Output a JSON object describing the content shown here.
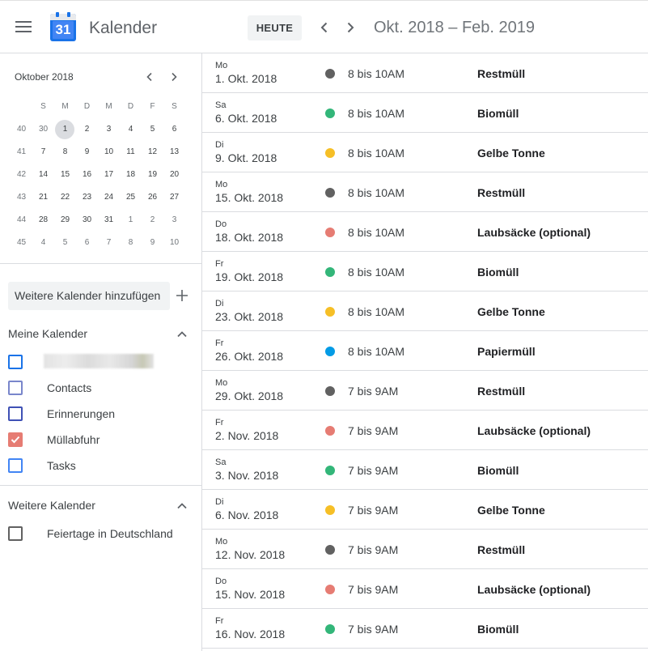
{
  "header": {
    "app_title": "Kalender",
    "logo_day": "31",
    "today_label": "HEUTE",
    "date_range": "Okt. 2018 – Feb. 2019"
  },
  "mini_calendar": {
    "title": "Oktober 2018",
    "weekdays": [
      "S",
      "M",
      "D",
      "M",
      "D",
      "F",
      "S"
    ],
    "weeks": [
      {
        "wk": "40",
        "days": [
          "30",
          "1",
          "2",
          "3",
          "4",
          "5",
          "6"
        ]
      },
      {
        "wk": "41",
        "days": [
          "7",
          "8",
          "9",
          "10",
          "11",
          "12",
          "13"
        ]
      },
      {
        "wk": "42",
        "days": [
          "14",
          "15",
          "16",
          "17",
          "18",
          "19",
          "20"
        ]
      },
      {
        "wk": "43",
        "days": [
          "21",
          "22",
          "23",
          "24",
          "25",
          "26",
          "27"
        ]
      },
      {
        "wk": "44",
        "days": [
          "28",
          "29",
          "30",
          "31",
          "1",
          "2",
          "3"
        ]
      },
      {
        "wk": "45",
        "days": [
          "4",
          "5",
          "6",
          "7",
          "8",
          "9",
          "10"
        ]
      }
    ],
    "selected_day": "1"
  },
  "sidebar": {
    "add_calendar_label": "Weitere Kalender hinzufügen",
    "my_calendars_label": "Meine Kalender",
    "my_calendars": [
      {
        "label": "",
        "color": "#1a73e8",
        "checked": false,
        "blurred": true
      },
      {
        "label": "Contacts",
        "color": "#7986cb",
        "checked": false
      },
      {
        "label": "Erinnerungen",
        "color": "#3f51b5",
        "checked": false
      },
      {
        "label": "Müllabfuhr",
        "color": "#e67c73",
        "checked": true
      },
      {
        "label": "Tasks",
        "color": "#4285f4",
        "checked": false
      }
    ],
    "other_calendars_label": "Weitere Kalender",
    "other_calendars": [
      {
        "label": "Feiertage in Deutschland",
        "color": "#616161",
        "checked": false
      }
    ]
  },
  "events": [
    {
      "dow": "Mo",
      "date": "1. Okt. 2018",
      "time": "8 bis 10AM",
      "title": "Restmüll",
      "color": "#616161"
    },
    {
      "dow": "Sa",
      "date": "6. Okt. 2018",
      "time": "8 bis 10AM",
      "title": "Biomüll",
      "color": "#33b679"
    },
    {
      "dow": "Di",
      "date": "9. Okt. 2018",
      "time": "8 bis 10AM",
      "title": "Gelbe Tonne",
      "color": "#f6bf26"
    },
    {
      "dow": "Mo",
      "date": "15. Okt. 2018",
      "time": "8 bis 10AM",
      "title": "Restmüll",
      "color": "#616161"
    },
    {
      "dow": "Do",
      "date": "18. Okt. 2018",
      "time": "8 bis 10AM",
      "title": "Laubsäcke (optional)",
      "color": "#e67c73"
    },
    {
      "dow": "Fr",
      "date": "19. Okt. 2018",
      "time": "8 bis 10AM",
      "title": "Biomüll",
      "color": "#33b679"
    },
    {
      "dow": "Di",
      "date": "23. Okt. 2018",
      "time": "8 bis 10AM",
      "title": "Gelbe Tonne",
      "color": "#f6bf26"
    },
    {
      "dow": "Fr",
      "date": "26. Okt. 2018",
      "time": "8 bis 10AM",
      "title": "Papiermüll",
      "color": "#039be5"
    },
    {
      "dow": "Mo",
      "date": "29. Okt. 2018",
      "time": "7 bis 9AM",
      "title": "Restmüll",
      "color": "#616161"
    },
    {
      "dow": "Fr",
      "date": "2. Nov. 2018",
      "time": "7 bis 9AM",
      "title": "Laubsäcke (optional)",
      "color": "#e67c73"
    },
    {
      "dow": "Sa",
      "date": "3. Nov. 2018",
      "time": "7 bis 9AM",
      "title": "Biomüll",
      "color": "#33b679"
    },
    {
      "dow": "Di",
      "date": "6. Nov. 2018",
      "time": "7 bis 9AM",
      "title": "Gelbe Tonne",
      "color": "#f6bf26"
    },
    {
      "dow": "Mo",
      "date": "12. Nov. 2018",
      "time": "7 bis 9AM",
      "title": "Restmüll",
      "color": "#616161"
    },
    {
      "dow": "Do",
      "date": "15. Nov. 2018",
      "time": "7 bis 9AM",
      "title": "Laubsäcke (optional)",
      "color": "#e67c73"
    },
    {
      "dow": "Fr",
      "date": "16. Nov. 2018",
      "time": "7 bis 9AM",
      "title": "Biomüll",
      "color": "#33b679"
    }
  ]
}
